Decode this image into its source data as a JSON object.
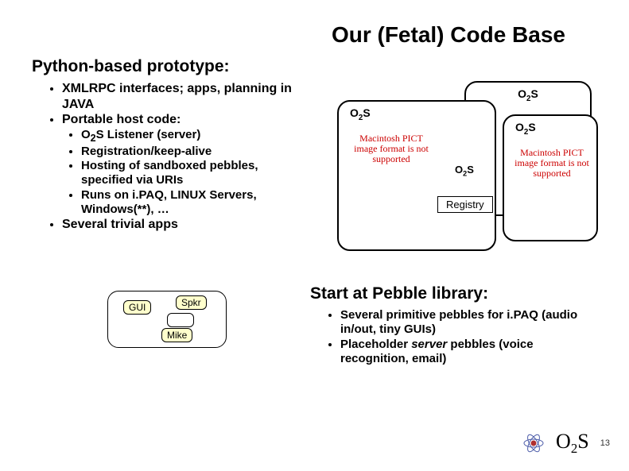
{
  "title": "Our (Fetal) Code Base",
  "section1": {
    "heading": "Python-based prototype:",
    "bullets": [
      "XMLRPC interfaces; apps, planning in JAVA",
      "Portable host code:",
      "Several trivial apps"
    ],
    "sub_bullets": [
      "O₂S Listener (server)",
      "Registration/keep-alive",
      "Hosting of sandboxed pebbles, specified via URIs",
      "Runs on i.PAQ, LINUX Servers, Windows(**), …"
    ]
  },
  "diagram": {
    "o2s_back": "O₂S",
    "o2s_main": "O₂S",
    "o2s_right": "O₂S",
    "o2s_small": "O₂S",
    "pict_text": "Macintosh PICT image format is not supported",
    "registry": "Registry"
  },
  "section2": {
    "heading": "Start at Pebble library:",
    "bullet1_a": "Several primitive pebbles for i.PAQ (audio in/out, tiny GUIs)",
    "bullet2_a": "Placeholder ",
    "bullet2_b": "server",
    "bullet2_c": " pebbles (voice recognition, email)"
  },
  "mini": {
    "gui": "GUI",
    "spkr": "Spkr",
    "mike": "Mike"
  },
  "footer": {
    "logo": "O₂S",
    "page": "13"
  }
}
